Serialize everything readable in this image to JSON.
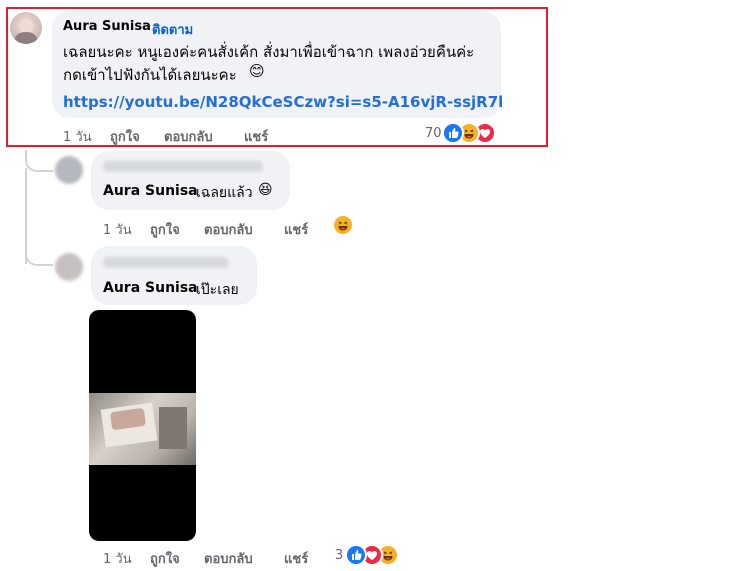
{
  "main_comment": {
    "author": "Aura Sunisa",
    "separator": "·",
    "follow_label": "ติดตาม",
    "text_line1": "เฉลยนะคะ หนูเองค่ะคนสั่งเค้ก สั่งมาเพื่อเข้าฉาก เพลงอ่วยคืนค่ะ",
    "text_line2": "กดเข้าไปฟังกันได้เลยนะคะ",
    "text_emoji": "😊",
    "link": "https://youtu.be/N28QkCeSCzw?si=s5-A16vjR-ssjR7l",
    "time": "1 วัน",
    "like": "ถูกใจ",
    "reply": "ตอบกลับ",
    "share": "แชร์",
    "reaction_count": "70"
  },
  "reply1": {
    "mention": "Aura Sunisa",
    "text": "เฉลยแล้ว",
    "emoji": "😆",
    "time": "1 วัน",
    "like": "ถูกใจ",
    "reply": "ตอบกลับ",
    "share": "แชร์"
  },
  "reply2": {
    "mention": "Aura Sunisa",
    "text": "เป๊ะเลย",
    "time": "1 วัน",
    "like": "ถูกใจ",
    "reply": "ตอบกลับ",
    "share": "แชร์",
    "reaction_count": "3"
  },
  "colors": {
    "highlight": "#e0212b",
    "link": "#216fdb",
    "follow": "#0064d1",
    "like_blue": "#1877f2",
    "love_red": "#f02849",
    "haha_yellow": "#f7b125"
  },
  "icons": {
    "like": "thumbs-up-icon",
    "haha": "laughing-face-icon",
    "love": "heart-icon",
    "video": "video-thumbnail"
  }
}
